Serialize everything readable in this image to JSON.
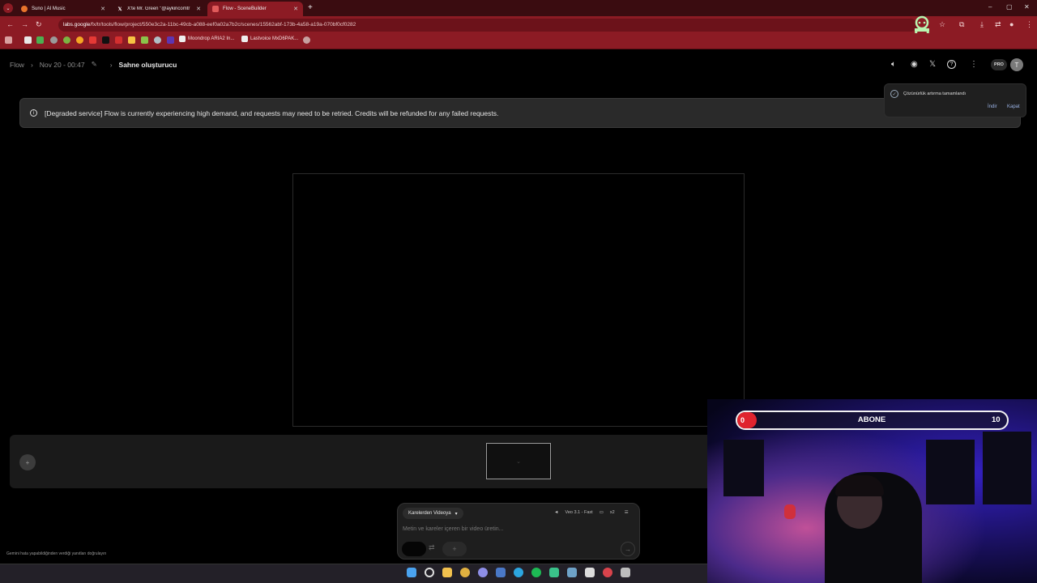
{
  "browser": {
    "tabs": [
      {
        "title": "Suno | AI Music",
        "icon": "suno-icon",
        "color": "#e8742c"
      },
      {
        "title": "X'te Mr. Green \"@aykiricomtr @",
        "icon": "x-icon",
        "color": "#ffffff"
      },
      {
        "title": "Flow - SceneBuilder",
        "icon": "flow-icon",
        "color": "#e05a5a"
      }
    ],
    "new_tab": "+",
    "url_host": "labs.google",
    "url_path": "/fx/tr/tools/flow/project/550e3c2a-11bc-49cb-a088-eef0a02a7b2c/scenes/15562abf-173b-4a58-a19a-070bf0cf0282",
    "bookmarks": [
      {
        "label": "Moondrop ARIA2 In..."
      },
      {
        "label": "Lastvoice MxD6PAK..."
      }
    ],
    "window_controls": [
      "–",
      "▢",
      "✕"
    ],
    "theme_color": "#8c1b24"
  },
  "header": {
    "breadcrumb_root": "Flow",
    "breadcrumb_project": "Nov 20 - 00:47",
    "breadcrumb_current": "Sahne oluşturucu",
    "pro_badge": "PRO",
    "avatar_initial": "T"
  },
  "banner": {
    "text": "[Degraded service] Flow is currently experiencing high demand, and requests may need to be retried. Credits will be refunded for any failed requests."
  },
  "toast": {
    "message": "Çözünürlük artırma tamamlandı",
    "download": "İndir",
    "close": "Kapat"
  },
  "prompt": {
    "mode": "Karelerden Videoya",
    "model": "Veo 3.1 - Fast",
    "count": "x2",
    "placeholder": "Metin ve kareler içeren bir video üretin..."
  },
  "disclaimer": "Gemini hata yapabildiğinden verdiği yanıtları doğrulayın",
  "overlay": {
    "subscriber_label": "ABONE",
    "current": "0",
    "goal": "10",
    "progress_fraction": 0
  }
}
